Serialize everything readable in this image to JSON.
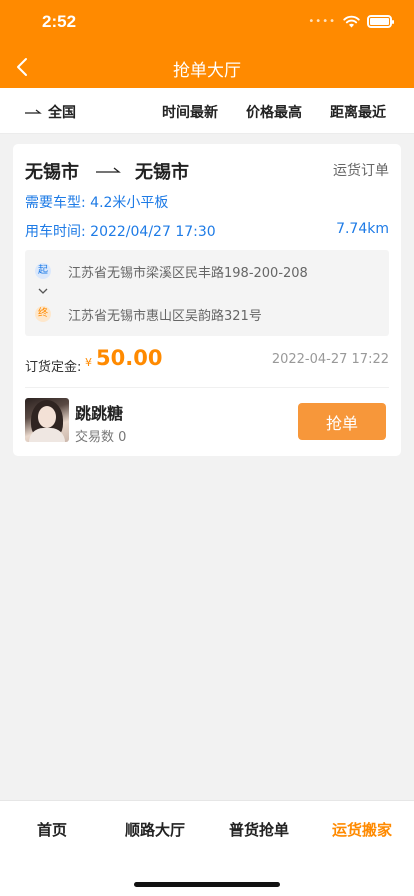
{
  "status_bar": {
    "time": "2:52"
  },
  "nav": {
    "title": "抢单大厅"
  },
  "filters": {
    "all_label": "全国",
    "options": [
      "时间最新",
      "价格最高",
      "距离最近"
    ]
  },
  "order": {
    "from_city": "无锡市",
    "to_city": "无锡市",
    "order_type": "运货订单",
    "vehicle_label": "需要车型:",
    "vehicle_value": "4.2米小平板",
    "use_time_label": "用车时间:",
    "use_time_value": "2022/04/27 17:30",
    "distance": "7.74km",
    "start_marker": "起",
    "start_address": "江苏省无锡市梁溪区民丰路198-200-208",
    "end_marker": "终",
    "end_address": "江苏省无锡市惠山区吴韵路321号",
    "deposit_label": "订货定金:",
    "currency_symbol": "¥",
    "deposit_amount": "50.00",
    "created_time": "2022-04-27 17:22",
    "user_name": "跳跳糖",
    "trade_count_label": "交易数 0",
    "grab_button": "抢单"
  },
  "tabs": [
    {
      "label": "首页",
      "active": false
    },
    {
      "label": "顺路大厅",
      "active": false
    },
    {
      "label": "普货抢单",
      "active": false
    },
    {
      "label": "运货搬家",
      "active": true
    }
  ],
  "colors": {
    "accent": "#ff8a00",
    "link": "#1e7be6"
  }
}
